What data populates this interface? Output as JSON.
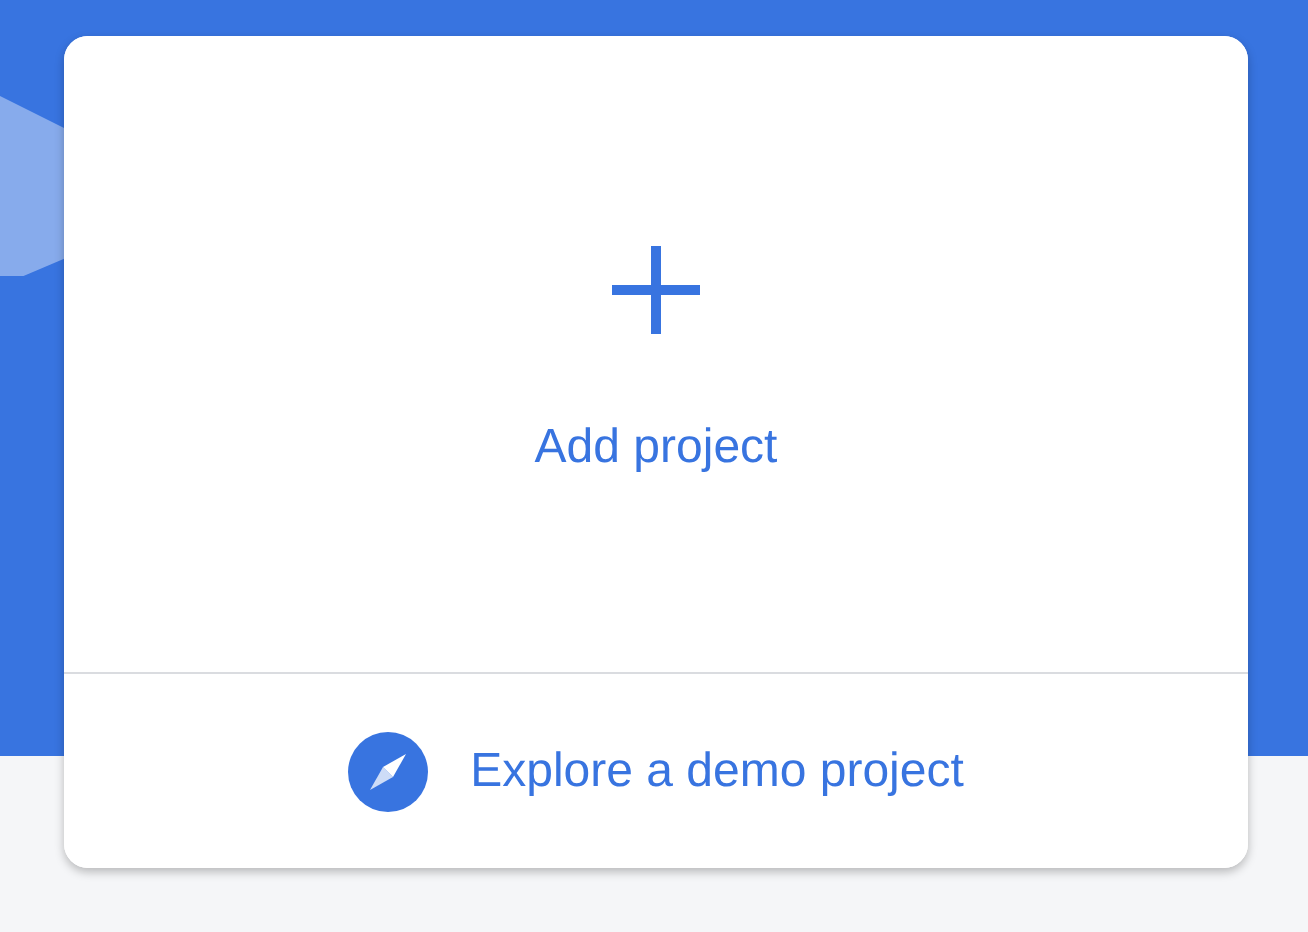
{
  "add_project": {
    "label": "Add project"
  },
  "demo_project": {
    "label": "Explore a demo project"
  }
}
